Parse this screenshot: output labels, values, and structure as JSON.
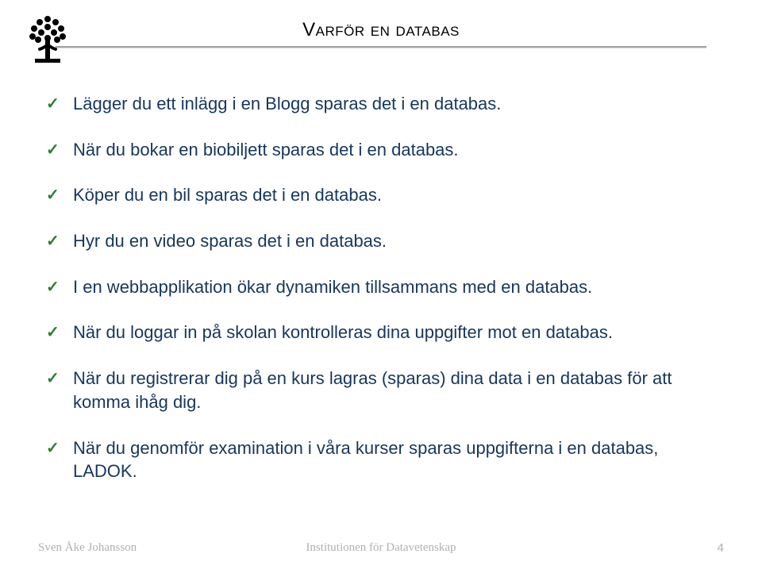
{
  "title": "Varför en databas",
  "bullets": [
    "Lägger du ett inlägg i en Blogg sparas det i en  databas.",
    "När du bokar en biobiljett sparas det i en databas.",
    "Köper du en bil sparas det i en databas.",
    "Hyr du en video sparas det i en databas.",
    "I en webbapplikation ökar dynamiken tillsammans med en databas.",
    "När du loggar in på skolan kontrolleras dina uppgifter mot en databas.",
    "När du registrerar dig på en kurs lagras (sparas) dina data i en databas för att komma ihåg dig.",
    "När du genomför examination i våra kurser sparas uppgifterna i en databas, LADOK."
  ],
  "footer": {
    "author": "Sven Åke Johansson",
    "institution": "Institutionen för Datavetenskap",
    "page": "4"
  }
}
